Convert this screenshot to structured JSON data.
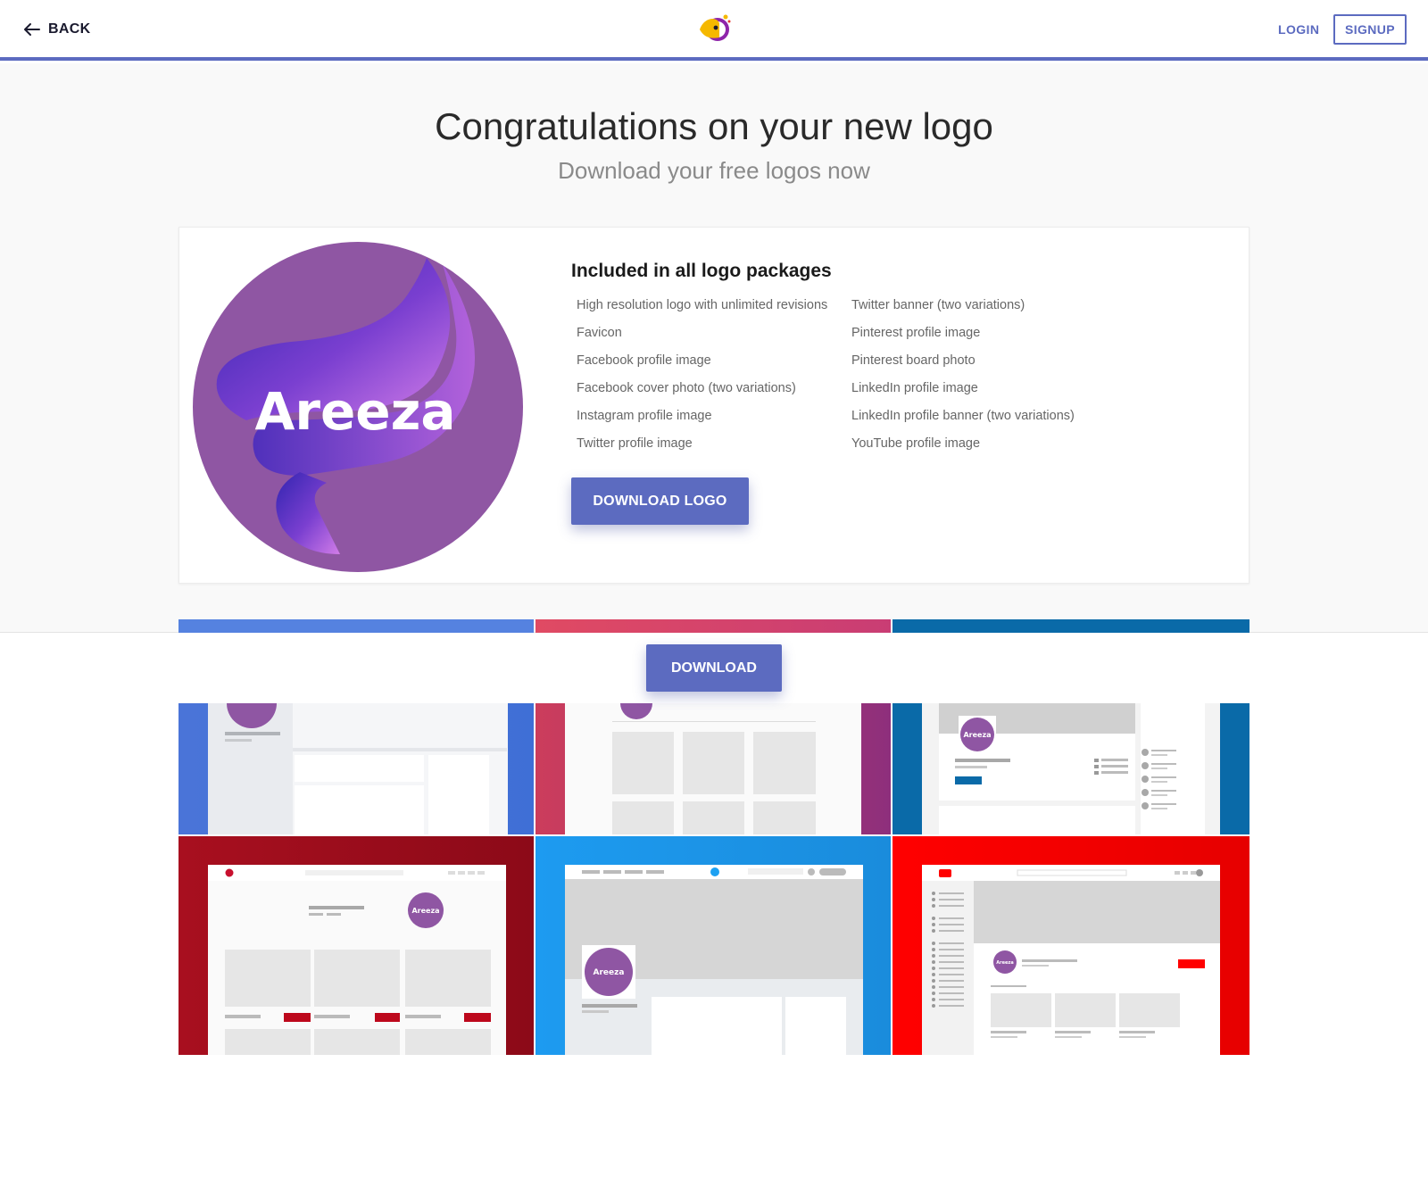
{
  "header": {
    "back_label": "BACK",
    "login_label": "LOGIN",
    "signup_label": "SIGNUP"
  },
  "hero": {
    "title": "Congratulations on your new logo",
    "subtitle": "Download your free logos now"
  },
  "logo": {
    "text": "Areeza",
    "colors": {
      "circle": "#8f56a3",
      "ribbon_dark": "#3a2bb0",
      "ribbon_light": "#c467e0"
    }
  },
  "packages": {
    "title": "Included in all logo packages",
    "left_items": [
      "High resolution logo with unlimited revisions",
      "Favicon",
      "Facebook profile image",
      "Facebook cover photo (two variations)",
      "Instagram profile image",
      "Twitter profile image"
    ],
    "right_items": [
      "Twitter banner (two variations)",
      "Pinterest profile image",
      "Pinterest board photo",
      "LinkedIn profile image",
      "LinkedIn profile banner (two variations)",
      "YouTube profile image"
    ],
    "download_logo_label": "DOWNLOAD LOGO"
  },
  "download_label": "DOWNLOAD",
  "previews": [
    {
      "name": "facebook-preview",
      "color": "#4a7de0"
    },
    {
      "name": "instagram-preview",
      "color": "#d14068"
    },
    {
      "name": "linkedin-preview",
      "color": "#0a6aa8"
    },
    {
      "name": "pinterest-preview",
      "color": "#a80f1f"
    },
    {
      "name": "twitter-preview",
      "color": "#1da1f2"
    },
    {
      "name": "youtube-preview",
      "color": "#ff0000"
    }
  ],
  "preview_logo_label": "Areeza",
  "colors": {
    "accent": "#5c6bc0"
  }
}
